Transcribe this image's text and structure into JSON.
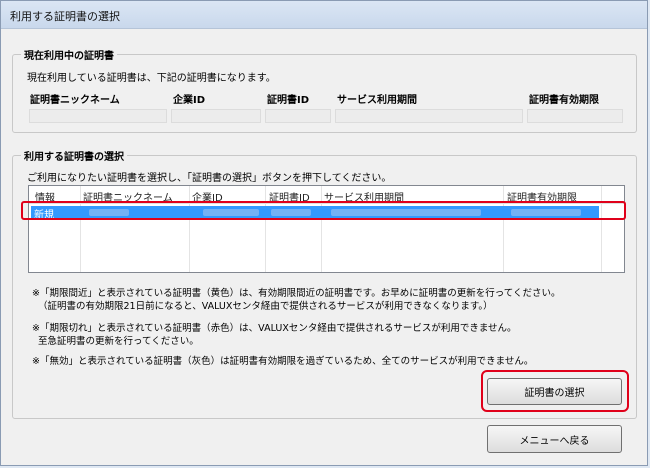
{
  "window": {
    "title": "利用する証明書の選択"
  },
  "current": {
    "group_title": "現在利用中の証明書",
    "description": "現在利用している証明書は、下記の証明書になります。",
    "headers": [
      "証明書ニックネーム",
      "企業ID",
      "証明書ID",
      "サービス利用期間",
      "証明書有効期限"
    ]
  },
  "select": {
    "group_title": "利用する証明書の選択",
    "description": "ご利用になりたい証明書を選択し、「証明書の選択」ボタンを押下してください。",
    "columns": [
      "情報",
      "証明書ニックネーム",
      "企業ID",
      "証明書ID",
      "サービス利用期間",
      "証明書有効期限"
    ],
    "rows": [
      {
        "info": "新規",
        "selected": true
      }
    ]
  },
  "notes": {
    "n1_line1": "※「期限間近」と表示されている証明書（黄色）は、有効期限間近の証明書です。お早めに証明書の更新を行ってください。",
    "n1_line2": "（証明書の有効期限21日前になると、VALUXセンタ経由で提供されるサービスが利用できなくなります。）",
    "n2_line1": "※「期限切れ」と表示されている証明書（赤色）は、VALUXセンタ経由で提供されるサービスが利用できません。",
    "n2_line2": "至急証明書の更新を行ってください。",
    "n3_line1": "※「無効」と表示されている証明書（灰色）は証明書有効期限を過ぎているため、全てのサービスが利用できません。"
  },
  "buttons": {
    "select_cert": "証明書の選択",
    "back_to_menu": "メニューへ戻る"
  },
  "colors": {
    "selection": "#3399ff",
    "highlight": "#e0001a"
  }
}
